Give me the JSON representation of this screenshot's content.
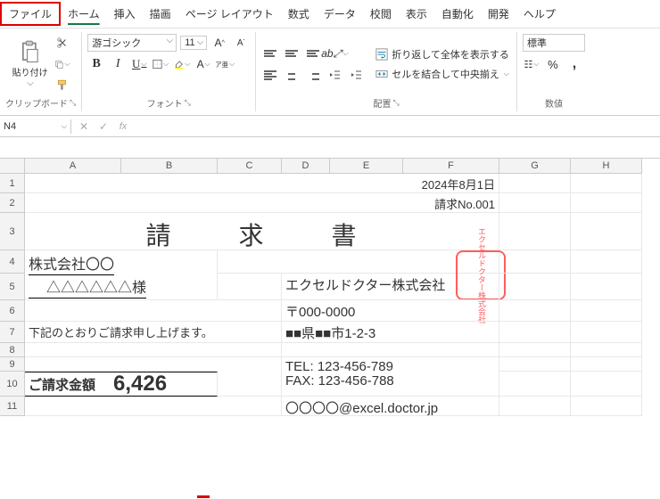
{
  "menu": {
    "file": "ファイル",
    "home": "ホーム",
    "insert": "挿入",
    "draw": "描画",
    "layout": "ページ レイアウト",
    "formulas": "数式",
    "data": "データ",
    "review": "校閲",
    "view": "表示",
    "auto": "自動化",
    "dev": "開発",
    "help": "ヘルプ"
  },
  "ribbon": {
    "clipboard": {
      "paste": "貼り付け",
      "group": "クリップボード"
    },
    "font": {
      "name": "游ゴシック",
      "size": "11",
      "group": "フォント"
    },
    "align": {
      "wrap": "折り返して全体を表示する",
      "merge": "セルを結合して中央揃え",
      "group": "配置"
    },
    "number": {
      "format": "標準",
      "group": "数値"
    }
  },
  "namebox": "N4",
  "columns": [
    "A",
    "B",
    "C",
    "D",
    "E",
    "F",
    "G",
    "H"
  ],
  "rows": [
    "1",
    "2",
    "3",
    "4",
    "5",
    "6",
    "7",
    "8",
    "9",
    "10",
    "11"
  ],
  "doc": {
    "date": "2024年8月1日",
    "invoice_no": "請求No.001",
    "title": "請　求　書",
    "to_company": "株式会社〇〇",
    "to_person": "△△△△△△様",
    "from_company": "エクセルドクター株式会社",
    "postal": "〒000-0000",
    "address": "■■県■■市1-2-3",
    "note": "下記のとおりご請求申し上げます。",
    "tel": "TEL: 123-456-789",
    "fax": "FAX: 123-456-788",
    "email": "〇〇〇〇@excel.doctor.jp",
    "amount_label": "ご請求金額",
    "amount": "6,426",
    "stamp": "エクセルドクター株式会社"
  }
}
